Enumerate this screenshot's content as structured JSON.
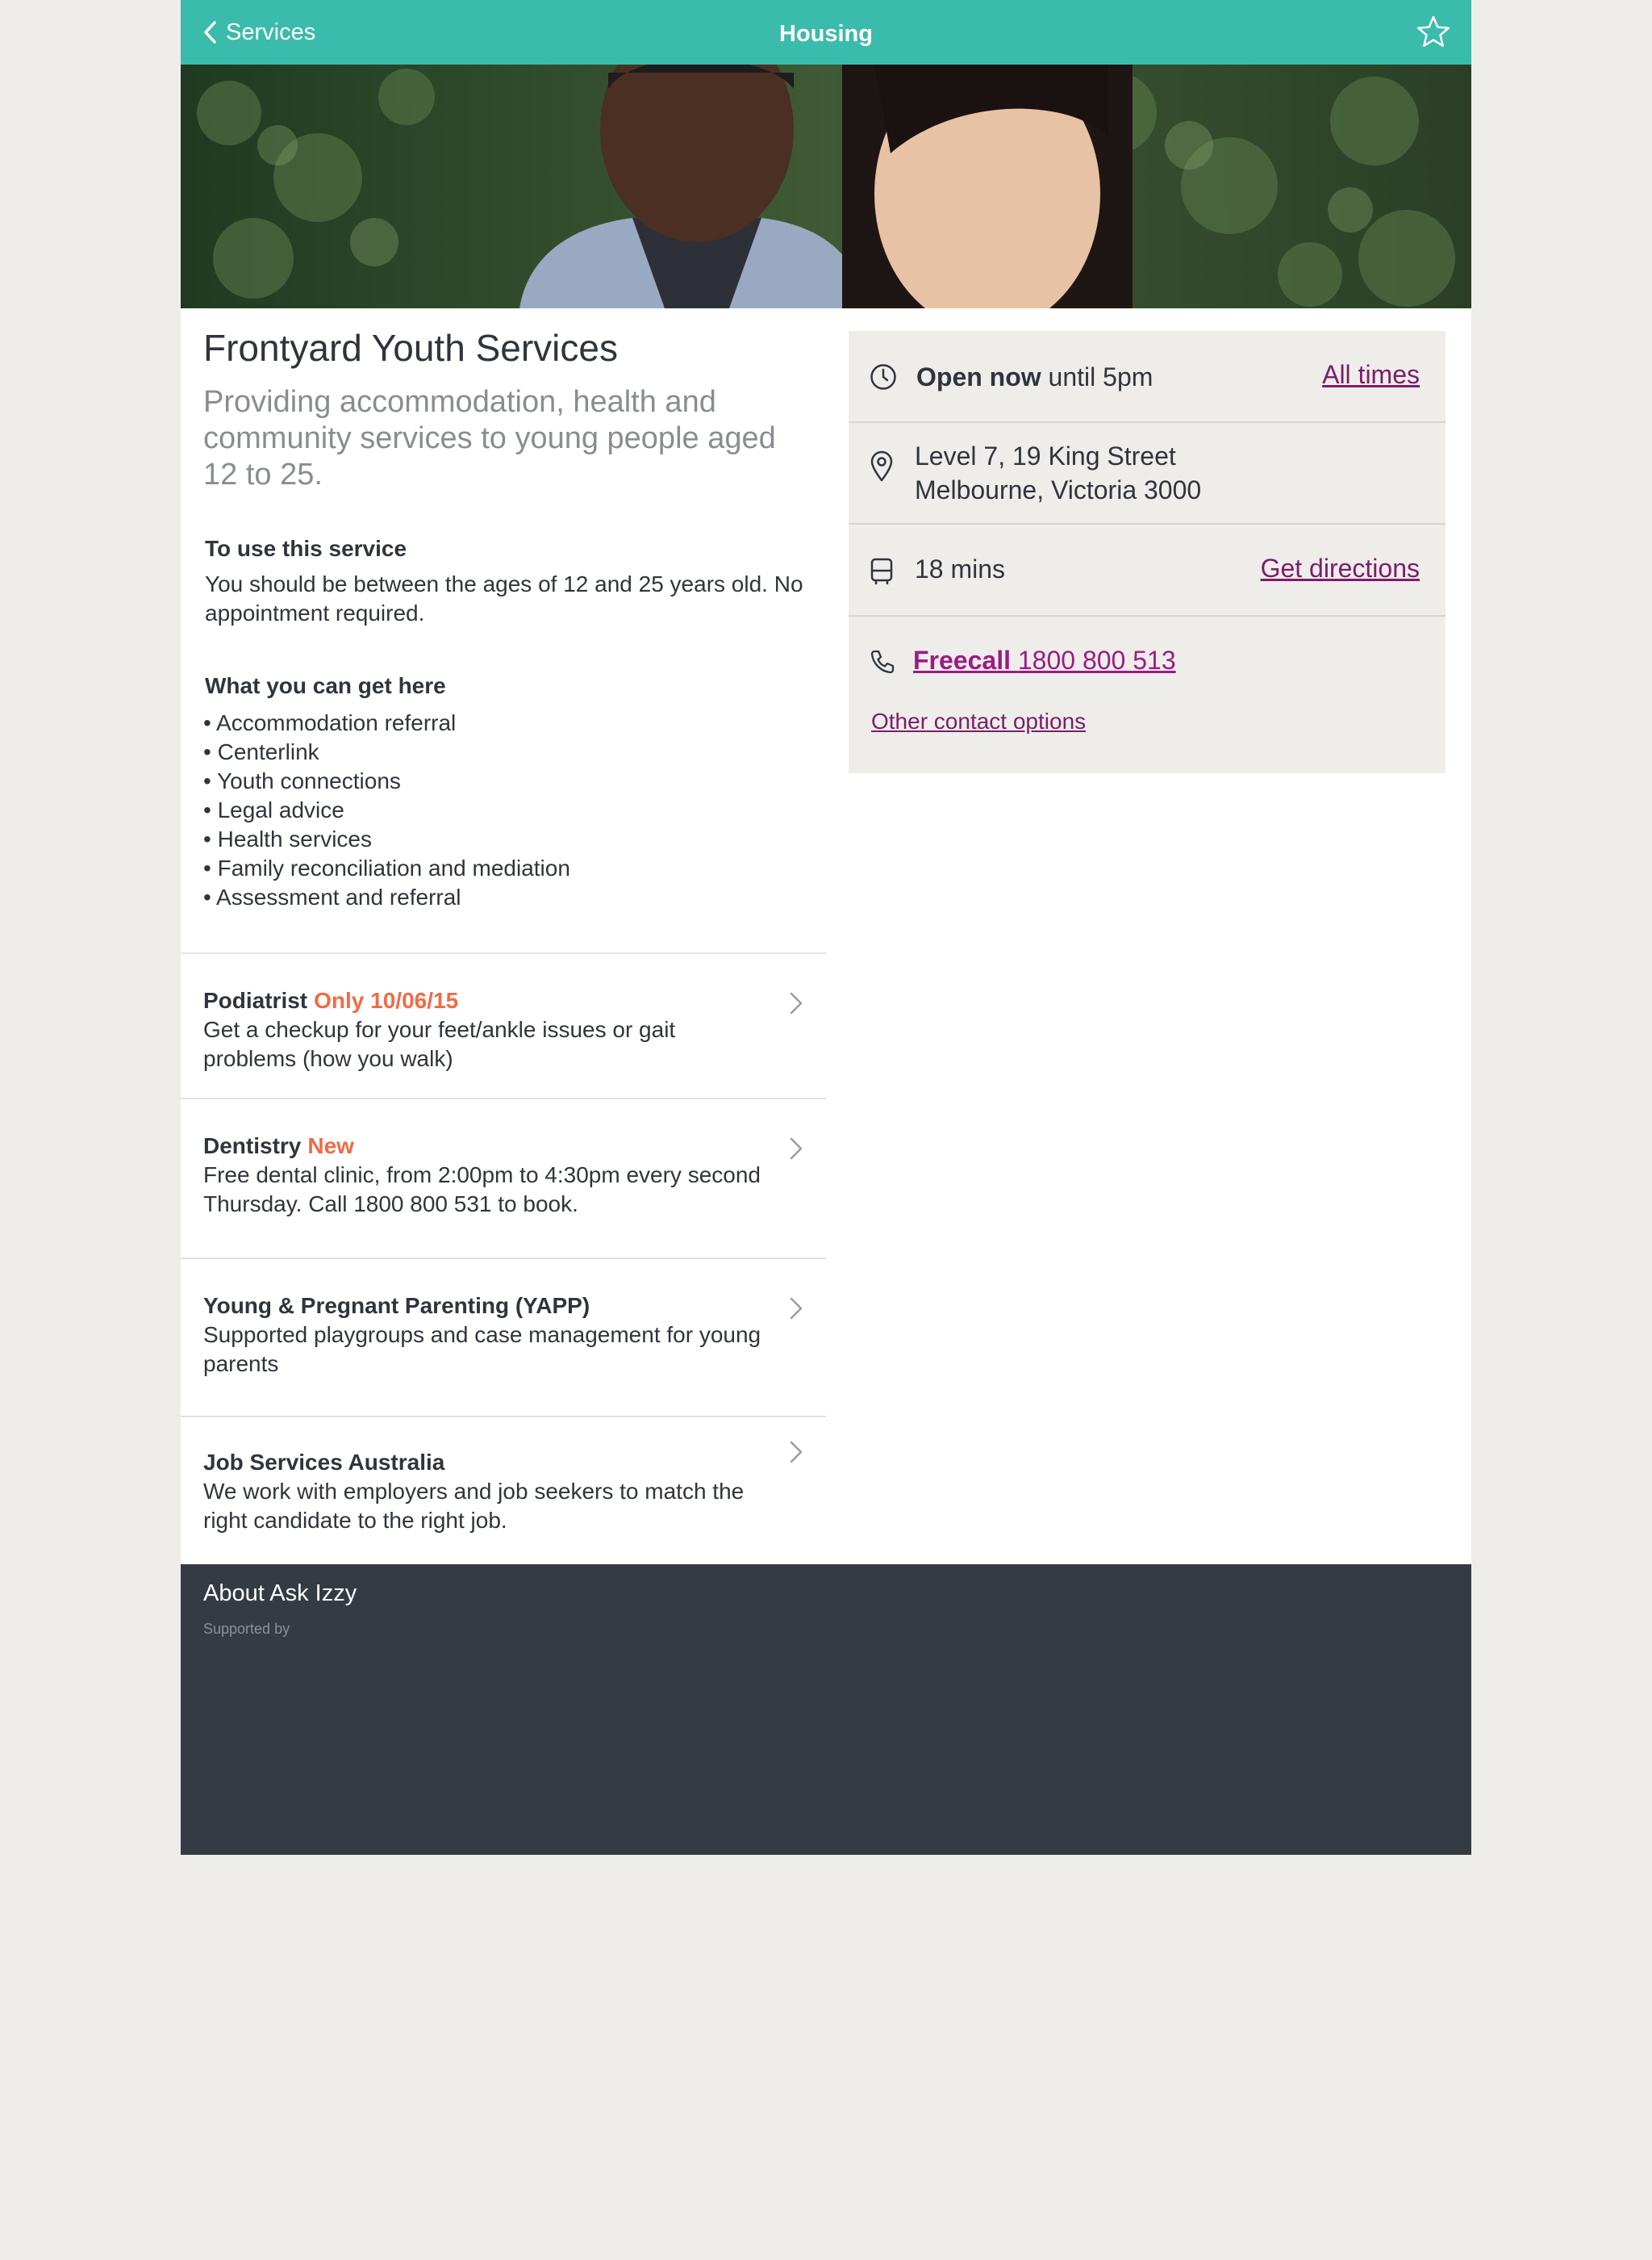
{
  "header": {
    "back_label": "Services",
    "title": "Housing"
  },
  "service": {
    "title": "Frontyard Youth Services",
    "description": "Providing accommodation, health and community services to young people aged 12 to 25.",
    "eligibility_heading": "To use this service",
    "eligibility_text": "You should be between the ages of 12 and 25 years old. No appointment required.",
    "offerings_heading": "What you can get here",
    "offerings": [
      "Accommodation referral",
      "Centerlink",
      "Youth connections",
      "Legal advice",
      "Health services",
      "Family reconciliation and mediation",
      "Assessment and referral"
    ]
  },
  "other_services": [
    {
      "name": "Podiatrist",
      "tag": "Only 10/06/15",
      "description": "Get a checkup for your feet/ankle issues or gait problems (how you walk)"
    },
    {
      "name": "Dentistry",
      "tag": "New",
      "description": "Free dental clinic, from 2:00pm to 4:30pm every second Thursday. Call 1800 800 531 to book."
    },
    {
      "name": "Young & Pregnant Parenting (YAPP)",
      "tag": "",
      "description": "Supported playgroups and case management for young parents"
    },
    {
      "name": "Job Services Australia",
      "tag": "",
      "description": "We work with employers and job seekers to match the right candidate to the right job."
    }
  ],
  "info": {
    "open_status": "Open now",
    "open_until": "until 5pm",
    "all_times_link": "All times",
    "address_line1": "Level 7, 19 King Street",
    "address_line2": "Melbourne, Victoria 3000",
    "travel_time": "18 mins",
    "directions_link": "Get directions",
    "phone_label": "Freecall",
    "phone_number": "1800 800 513",
    "other_contact_link": "Other contact options"
  },
  "footer": {
    "about_link": "About Ask Izzy",
    "supported_by": "Supported by"
  },
  "colors": {
    "header_teal": "#3bbbab",
    "link_purple": "#7b1d6a",
    "tag_orange": "#f06b45",
    "footer_dark": "#343b43",
    "page_bg": "#eeedea"
  },
  "icons": [
    "chevron-left-icon",
    "star-icon",
    "clock-icon",
    "map-pin-icon",
    "bus-icon",
    "phone-icon",
    "chevron-right-icon"
  ]
}
